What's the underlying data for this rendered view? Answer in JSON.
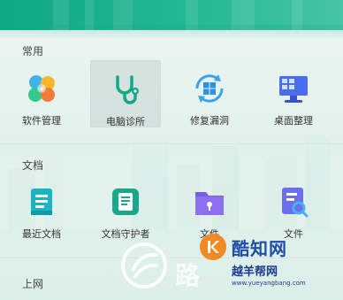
{
  "sections": {
    "common": {
      "title": "常用",
      "items": [
        {
          "label": "软件管理",
          "icon": "software-manager-icon"
        },
        {
          "label": "电脑诊所",
          "icon": "stethoscope-icon"
        },
        {
          "label": "修复漏洞",
          "icon": "windows-repair-icon"
        },
        {
          "label": "桌面整理",
          "icon": "desktop-organize-icon"
        }
      ]
    },
    "documents": {
      "title": "文档",
      "items": [
        {
          "label": "最近文档",
          "icon": "recent-documents-icon"
        },
        {
          "label": "文档守护者",
          "icon": "document-guardian-icon"
        },
        {
          "label": "文件",
          "icon": "locked-folder-icon"
        },
        {
          "label": "文件",
          "icon": "file-search-icon"
        }
      ]
    },
    "internet": {
      "title": "上网"
    }
  },
  "watermark": {
    "logo_text": "酷知网",
    "site_name": "越羊帮网",
    "site_url": "www.yueyangbang.com"
  },
  "colors": {
    "header_green": "#0fa884",
    "selected_tile": "#d2ded9"
  }
}
